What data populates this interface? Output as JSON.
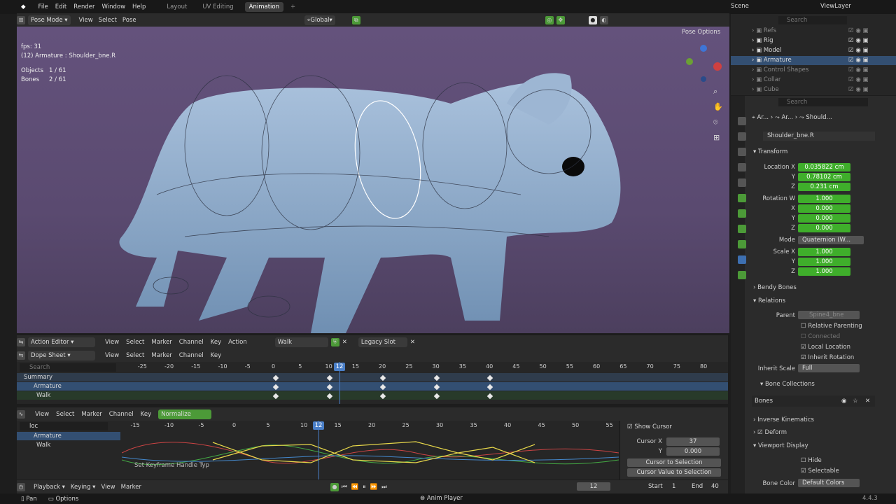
{
  "menu": {
    "items": [
      "File",
      "Edit",
      "Render",
      "Window",
      "Help"
    ],
    "tabs": [
      "Layout",
      "UV Editing",
      "Animation"
    ],
    "active_tab": "Animation",
    "scene": "Scene",
    "view_layer": "ViewLayer"
  },
  "viewport": {
    "mode": "Pose Mode",
    "menus": [
      "View",
      "Select",
      "Pose"
    ],
    "orientation": "Global",
    "pose_options": "Pose Options",
    "fps": "fps: 31",
    "active": "(12) Armature : Shoulder_bne.R",
    "stats": [
      {
        "k": "Objects",
        "v": "1 / 61"
      },
      {
        "k": "Bones",
        "v": "2 / 61"
      }
    ]
  },
  "outliner": {
    "search": "Search",
    "rows": [
      {
        "name": "Refs",
        "icon": "box-icon",
        "dim": true
      },
      {
        "name": "Rig",
        "icon": "collection-icon",
        "dim": false
      },
      {
        "name": "Model",
        "icon": "box-icon",
        "dim": false
      },
      {
        "name": "Armature",
        "icon": "armature-icon",
        "dim": false,
        "selected": true
      },
      {
        "name": "Control Shapes",
        "icon": "collection-icon",
        "dim": true
      },
      {
        "name": "Collar",
        "icon": "triangle-icon",
        "dim": true
      },
      {
        "name": "Cube",
        "icon": "triangle-icon",
        "dim": true
      }
    ]
  },
  "properties": {
    "search": "Search",
    "breadcrumb": [
      "Ar...",
      "Ar...",
      "Should..."
    ],
    "bone_name": "Shoulder_bne.R",
    "transform": "Transform",
    "location_label": "Location X",
    "location": [
      "0.035822 cm",
      "0.78102 cm",
      "0.231 cm"
    ],
    "rotation_label": "Rotation W",
    "rotation": [
      "1.000",
      "0.000",
      "0.000",
      "0.000"
    ],
    "mode_label": "Mode",
    "mode_value": "Quaternion (W...",
    "scale_label": "Scale X",
    "scale": [
      "1.000",
      "1.000",
      "1.000"
    ],
    "axes": [
      "X",
      "Y",
      "Z",
      "W"
    ],
    "bendy": "Bendy Bones",
    "relations": "Relations",
    "parent_label": "Parent",
    "parent_value": "Spine4_bne",
    "relative_parenting": "Relative Parenting",
    "connected": "Connected",
    "local_location": "Local Location",
    "inherit_rotation": "Inherit Rotation",
    "inherit_scale_label": "Inherit Scale",
    "inherit_scale_value": "Full",
    "bone_collections": "Bone Collections",
    "bones": "Bones",
    "inverse_kinematics": "Inverse Kinematics",
    "deform": "Deform",
    "viewport_display": "Viewport Display",
    "hide": "Hide",
    "selectable": "Selectable",
    "bone_color_label": "Bone Color",
    "bone_color_value": "Default Colors"
  },
  "action_editor": {
    "mode": "Action Editor",
    "menus": [
      "View",
      "Select",
      "Marker",
      "Channel",
      "Key",
      "Action"
    ],
    "action": "Walk",
    "slot": "Legacy Slot"
  },
  "dope_sheet": {
    "mode": "Dope Sheet",
    "menus": [
      "View",
      "Select",
      "Marker",
      "Channel",
      "Key"
    ],
    "search": "Search",
    "ticks": [
      "-25",
      "-20",
      "-15",
      "-10",
      "-5",
      "0",
      "5",
      "10",
      "15",
      "20",
      "25",
      "30",
      "35",
      "40",
      "45",
      "50",
      "55",
      "60",
      "65",
      "70",
      "75",
      "80"
    ],
    "current_frame": "12",
    "channels": [
      "Summary",
      "Armature",
      "Walk"
    ],
    "key_frames": [
      0,
      10,
      20,
      30,
      40
    ]
  },
  "graph": {
    "menus": [
      "View",
      "Select",
      "Marker",
      "Channel",
      "Key"
    ],
    "normalize": "Normalize",
    "filter": "loc",
    "ticks": [
      "-15",
      "-10",
      "-5",
      "0",
      "5",
      "10",
      "15",
      "20",
      "25",
      "30",
      "35",
      "40",
      "45",
      "50",
      "55"
    ],
    "current_frame": "12",
    "channels": [
      "Armature",
      "Walk"
    ],
    "last_op": "Set Keyframe Handle Typ",
    "show_cursor": "Show Cursor",
    "cursor_x_label": "Cursor X",
    "cursor_x": "37",
    "cursor_y_label": "Y",
    "cursor_y": "0.000",
    "cursor_to_selection": "Cursor to Selection",
    "cursor_value_to_selection": "Cursor Value to Selection"
  },
  "timeline": {
    "menus": [
      "Playback",
      "Keying",
      "View",
      "Marker"
    ],
    "frame": "12",
    "start_label": "Start",
    "start": "1",
    "end_label": "End",
    "end": "40"
  },
  "status": {
    "pan": "Pan",
    "options": "Options",
    "center": "Anim Player",
    "version": "4.4.3"
  },
  "colors": {
    "viewport_bg": "#5d4d74",
    "model": "#8ba9cc",
    "accent": "#3fae2b",
    "selected": "#334f72"
  }
}
